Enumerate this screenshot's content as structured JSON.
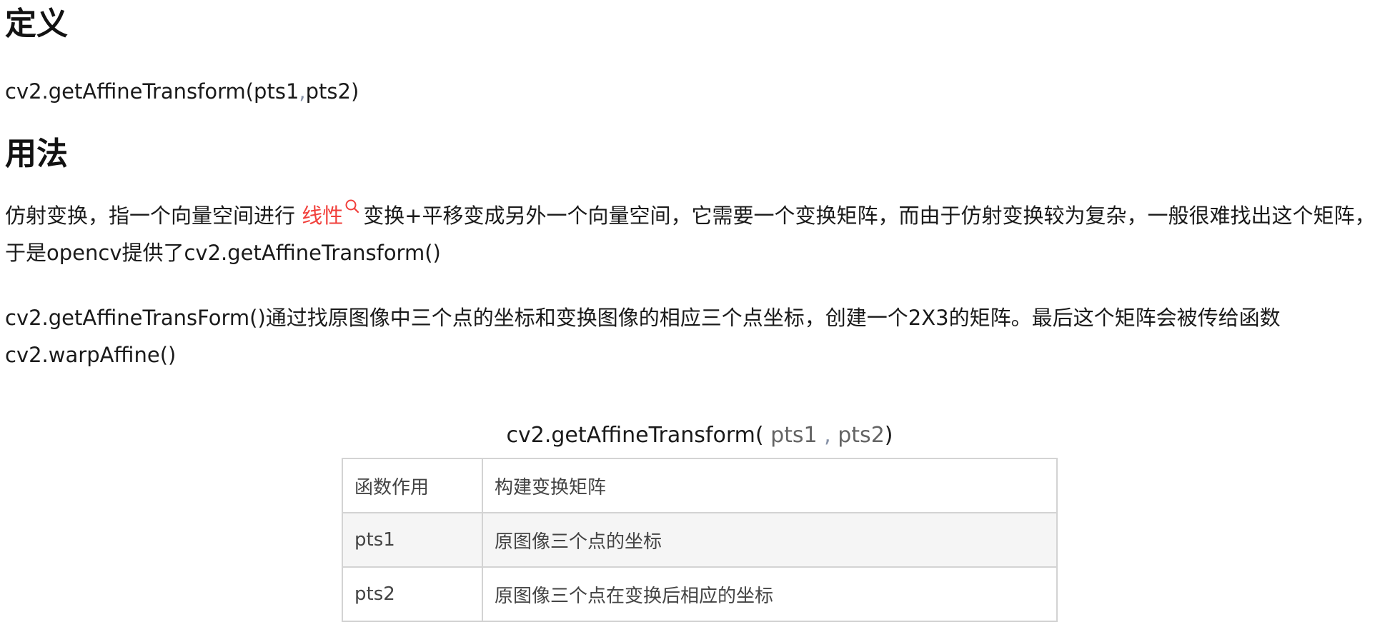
{
  "headings": {
    "definition": "定义",
    "usage": "用法"
  },
  "definition": {
    "fn": "cv2.getAffineTransform(pts1",
    "sep": ",",
    "arg2": "pts2)"
  },
  "paragraph1": {
    "before_link": "仿射变换，指一个向量空间进行 ",
    "link_text": "线性",
    "after_link": "变换+平移变成另外一个向量空间，它需要一个变换矩阵，而由于仿射变换较为复杂，一般很难找出这个矩阵，于是opencv提供了cv2.getAffineTransform()"
  },
  "paragraph2": "cv2.getAffineTransForm()通过找原图像中三个点的坐标和变换图像的相应三个点坐标，创建一个2X3的矩阵。最后这个矩阵会被传给函数cv2.warpAffine()",
  "table": {
    "caption": {
      "fn": "cv2.getAffineTransform(",
      "arg1": " pts1 ",
      "comma": ",",
      "arg2": " pts2",
      "close": ")"
    },
    "rows": [
      [
        "函数作用",
        "构建变换矩阵"
      ],
      [
        "pts1",
        "原图像三个点的坐标"
      ],
      [
        "pts2",
        "原图像三个点在变换后相应的坐标"
      ]
    ]
  },
  "colors": {
    "text": "#121212",
    "link": "#f1403c",
    "table_border": "#d3d3d3",
    "table_alt_row": "#f5f5f5"
  },
  "icons": {
    "link_search": "search-icon"
  }
}
